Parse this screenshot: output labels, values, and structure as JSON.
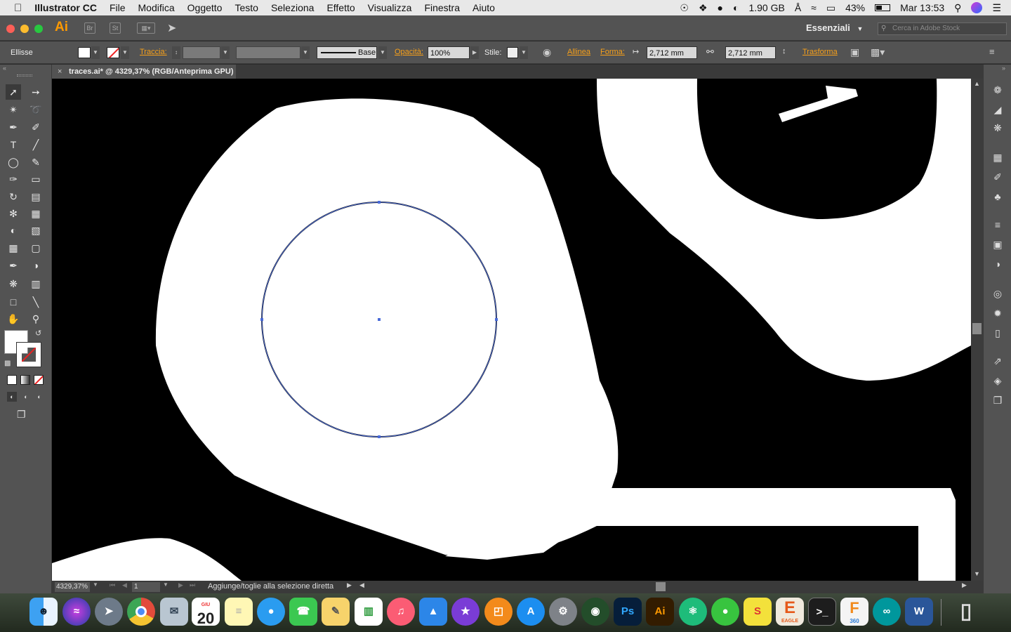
{
  "menubar": {
    "app_name": "Illustrator CC",
    "items": [
      "File",
      "Modifica",
      "Oggetto",
      "Testo",
      "Seleziona",
      "Effetto",
      "Visualizza",
      "Finestra",
      "Aiuto"
    ],
    "memory": "1.90 GB",
    "battery": "43%",
    "clock": "Mar 13:53"
  },
  "appbar": {
    "logo": "Ai",
    "bridge": "Br",
    "stock": "St",
    "workspace": "Essenziali",
    "search_placeholder": "Cerca in Adobe Stock"
  },
  "control": {
    "object_type": "Ellisse",
    "stroke_label": "Traccia:",
    "brush_label": "Base",
    "opacity_label": "Opacità:",
    "opacity_value": "100%",
    "style_label": "Stile:",
    "align_label": "Allinea",
    "shape_label": "Forma:",
    "width_value": "2,712 mm",
    "height_value": "2,712 mm",
    "transform_label": "Trasforma"
  },
  "document": {
    "tab_title": "traces.ai* @ 4329,37% (RGB/Anteprima GPU)"
  },
  "status": {
    "zoom": "4329,37%",
    "artboard": "1",
    "message": "Aggiunge/toglie alla selezione diretta"
  },
  "colors": {
    "accent": "#f7a01a",
    "selection": "#4a6bd8",
    "canvas_bg": "#000000",
    "art": "#ffffff"
  },
  "dock": {
    "calendar_day": "20",
    "calendar_month": "GIU",
    "ps": "Ps",
    "ai": "Ai",
    "eagle": "E",
    "eagle_label": "EAGLE",
    "fusion": "F",
    "fusion_label": "360",
    "word": "W"
  }
}
